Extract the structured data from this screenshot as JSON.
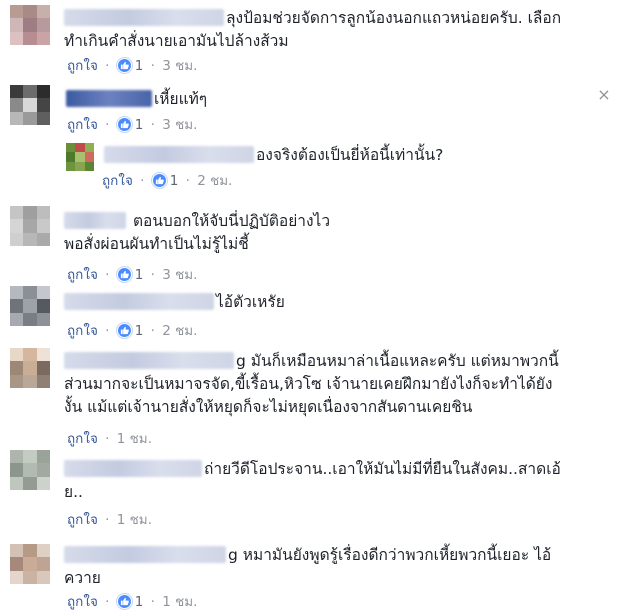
{
  "comments": [
    {
      "lines": [
        "ลุงป้อมช่วยจัดการลูกน้องนอกแถวหน่อยครับ. เลือก",
        "ทำเกินคำสั่งนายเอามันไปล้างส้วม"
      ],
      "like_label": "ถูกใจ",
      "reactions": "1",
      "time": "3 ชม."
    },
    {
      "lines": [
        "เหี้ยแท้ๆ"
      ],
      "like_label": "ถูกใจ",
      "reactions": "1",
      "time": "3 ชม."
    },
    {
      "lines": [
        "องจริงต้องเป็นยี่ห้อนี้เท่านั้น?"
      ],
      "like_label": "ถูกใจ",
      "reactions": "1",
      "time": "2 ชม."
    },
    {
      "lines": [
        "ตอนบอกให้จับนี่ปฏิบัติอย่างไว",
        "พอสั่งผ่อนผันทำเป็นไม่รู้ไม่ชี้"
      ],
      "like_label": "ถูกใจ",
      "reactions": "1",
      "time": "3 ชม."
    },
    {
      "lines": [
        "ไอ้ตัวเหรัย"
      ],
      "like_label": "ถูกใจ",
      "reactions": "1",
      "time": "2 ชม."
    },
    {
      "lines": [
        "g มันก็เหมือนหมาล่าเนื้อแหละครับ แต่หมาพวกนี้",
        "ส่วนมากจะเป็นหมาจรจัด,ขี้เรื้อน,หิวโซ เจ้านายเคยฝึกมายังไงก็จะทำได้ยัง",
        "งั้น แม้แต่เจ้านายสั่งให้หยุดก็จะไม่หยุดเนื่องจากสันดานเคยชิน"
      ],
      "like_label": "ถูกใจ",
      "time": "1 ชม."
    },
    {
      "lines": [
        "ถ่ายวีดีโอประจาน..เอาให้มันไม่มีที่ยืนในสังคม..สาดเอ้",
        "ย.."
      ],
      "like_label": "ถูกใจ",
      "time": "1 ชม."
    },
    {
      "lines": [
        "g หมามันยังพูดรู้เรื่องดีกว่าพวกเหี้ยพวกนี้เยอะ ไอ้",
        "ควาย"
      ],
      "like_label": "ถูกใจ",
      "reactions": "1",
      "time": "1 ชม."
    }
  ],
  "close_glyph": "×",
  "dot": "·",
  "colors": {
    "link": "#365899",
    "meta": "#90949c",
    "reaction": "#4a8cff"
  }
}
